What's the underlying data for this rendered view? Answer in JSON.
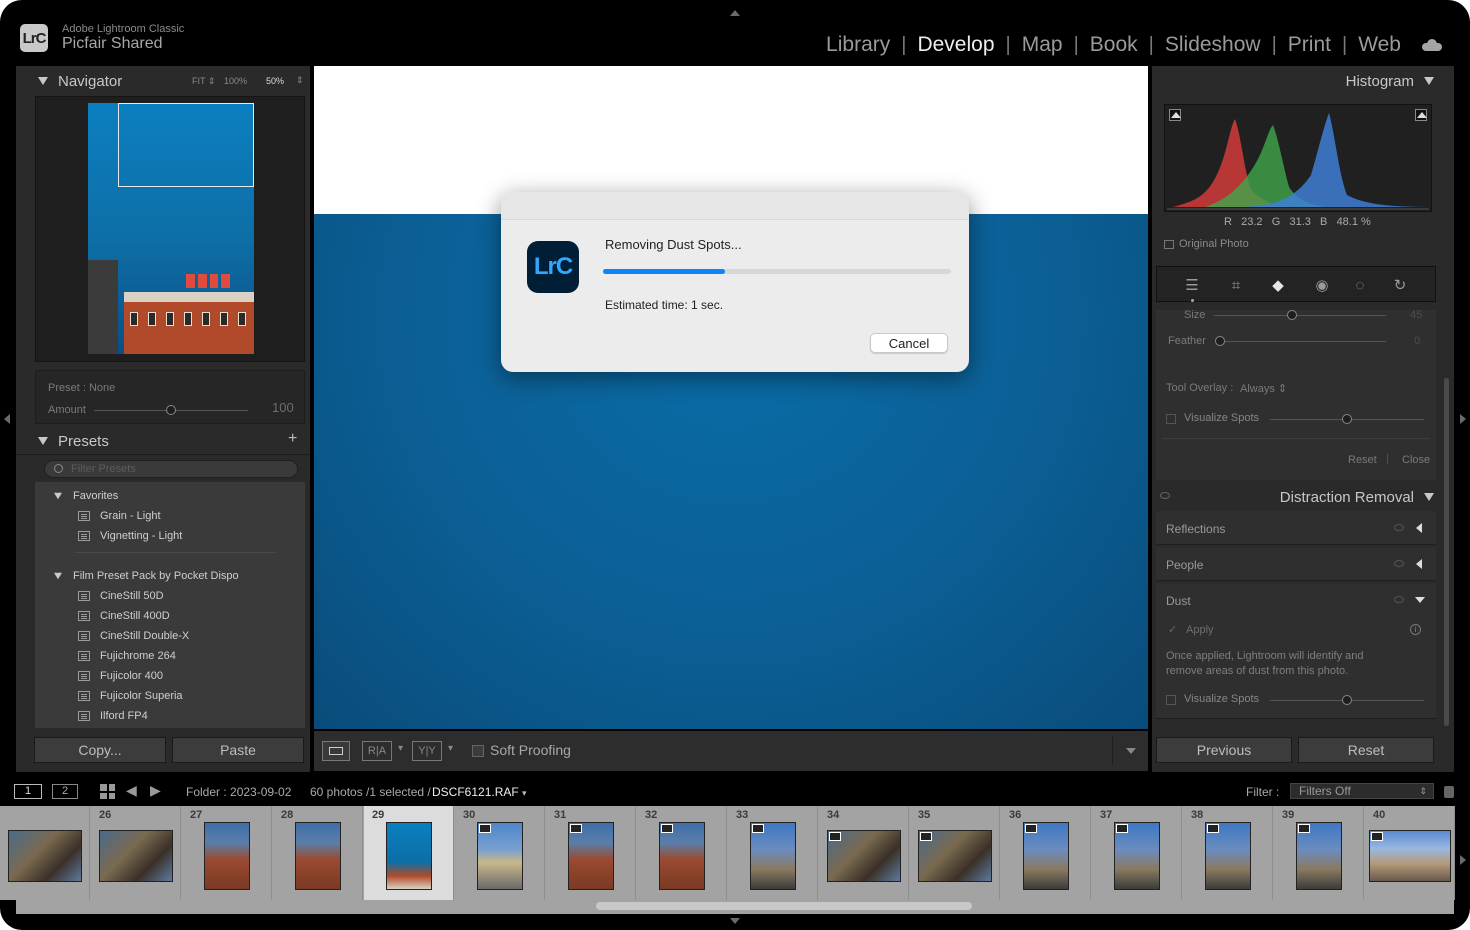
{
  "app": {
    "name": "Adobe Lightroom Classic",
    "catalog": "Picfair Shared",
    "logo_text": "LrC"
  },
  "modules": [
    {
      "label": "Library",
      "active": false
    },
    {
      "label": "Develop",
      "active": true
    },
    {
      "label": "Map",
      "active": false
    },
    {
      "label": "Book",
      "active": false
    },
    {
      "label": "Slideshow",
      "active": false
    },
    {
      "label": "Print",
      "active": false
    },
    {
      "label": "Web",
      "active": false
    }
  ],
  "navigator": {
    "title": "Navigator",
    "zoom_fit": "FIT",
    "zoom_100": "100%",
    "zoom_50": "50%"
  },
  "preset_amount": {
    "preset_label": "Preset : None",
    "amount_label": "Amount",
    "amount_value": "100",
    "amount_level": 0.5
  },
  "presets": {
    "title": "Presets",
    "filter_placeholder": "Filter Presets",
    "groups": [
      {
        "name": "Favorites",
        "items": [
          "Grain - Light",
          "Vignetting - Light"
        ]
      },
      {
        "name": "Film Preset Pack by Pocket Dispo",
        "items": [
          "CineStill 50D",
          "CineStill 400D",
          "CineStill Double-X",
          "Fujichrome 264",
          "Fujicolor 400",
          "Fujicolor Superia",
          "Ilford FP4"
        ]
      }
    ]
  },
  "left_buttons": {
    "copy": "Copy...",
    "paste": "Paste"
  },
  "toolbar": {
    "soft_proofing": "Soft Proofing"
  },
  "dialog": {
    "logo_text": "LrC",
    "title": "Removing Dust Spots...",
    "progress": 0.35,
    "estimated": "Estimated time: 1 sec.",
    "cancel": "Cancel"
  },
  "histogram": {
    "title": "Histogram",
    "r_label": "R",
    "r_value": "23.2",
    "g_label": "G",
    "g_value": "31.3",
    "b_label": "B",
    "b_value": "48.1",
    "pct": "%",
    "original_photo": "Original Photo"
  },
  "spot_settings": {
    "size_label": "Size",
    "size_value": "45",
    "feather_label": "Feather",
    "feather_value": "0",
    "tool_overlay_label": "Tool Overlay :",
    "tool_overlay_value": "Always",
    "visualize_spots": "Visualize Spots",
    "reset": "Reset",
    "close": "Close"
  },
  "distraction_removal": {
    "title": "Distraction Removal",
    "rows": [
      {
        "label": "Reflections"
      },
      {
        "label": "People"
      },
      {
        "label": "Dust"
      }
    ],
    "apply": "Apply",
    "note": "Once applied, Lightroom will identify and remove areas of dust from this photo.",
    "visualize_spots": "Visualize Spots"
  },
  "right_buttons": {
    "previous": "Previous",
    "reset": "Reset"
  },
  "filmstrip_header": {
    "view1": "1",
    "view2": "2",
    "folder": "Folder : 2023-09-02",
    "count": "60 photos /1 selected /",
    "filename": "DSCF6121.RAF",
    "filter_label": "Filter :",
    "filter_value": "Filters Off"
  },
  "filmstrip": [
    {
      "num": "",
      "kind": "statue"
    },
    {
      "num": "26",
      "kind": "statue"
    },
    {
      "num": "27",
      "kind": "brick"
    },
    {
      "num": "28",
      "kind": "brick"
    },
    {
      "num": "29",
      "kind": "blue",
      "selected": true
    },
    {
      "num": "30",
      "kind": "road"
    },
    {
      "num": "31",
      "kind": "brick"
    },
    {
      "num": "32",
      "kind": "brick"
    },
    {
      "num": "33",
      "kind": "statue-tall"
    },
    {
      "num": "34",
      "kind": "statue"
    },
    {
      "num": "35",
      "kind": "statue"
    },
    {
      "num": "36",
      "kind": "statue-tall"
    },
    {
      "num": "37",
      "kind": "statue-tall"
    },
    {
      "num": "38",
      "kind": "statue-tall"
    },
    {
      "num": "39",
      "kind": "statue-tall"
    },
    {
      "num": "40",
      "kind": "street"
    }
  ],
  "colors": {
    "accent": "#0a84ff",
    "photo_blue": "#0c5e93",
    "panel": "#2a2a2a"
  }
}
